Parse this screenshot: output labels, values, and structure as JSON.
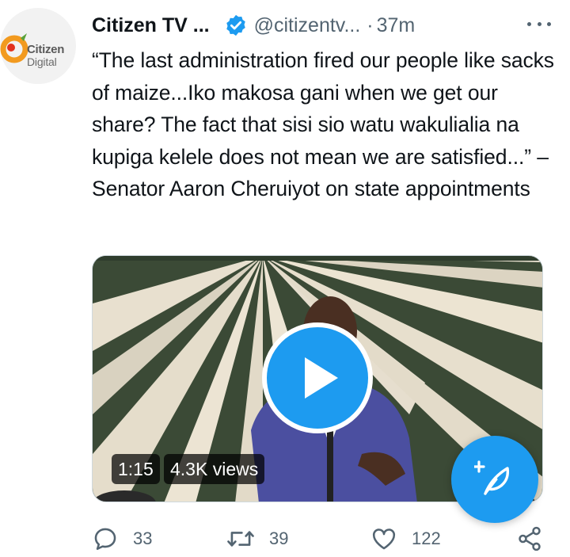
{
  "account": {
    "display_name": "Citizen TV ...",
    "handle": "@citizentv...",
    "separator": "·",
    "time": "37m",
    "avatar_text_line1": "Citizen",
    "avatar_text_line2": "Digital"
  },
  "tweet": {
    "text": "“The last administration fired our people like sacks of maize...Iko makosa gani when we get our share? The fact that sisi sio watu wakulialia na kupiga kelele does not mean we are satisfied...” – Senator Aaron Cheruiyot on state appointments"
  },
  "media": {
    "duration": "1:15",
    "views": "4.3K views"
  },
  "actions": {
    "reply_count": "33",
    "retweet_count": "39",
    "like_count": "122"
  },
  "colors": {
    "accent": "#1d9bf0",
    "text": "#0f1419",
    "muted": "#536471"
  }
}
